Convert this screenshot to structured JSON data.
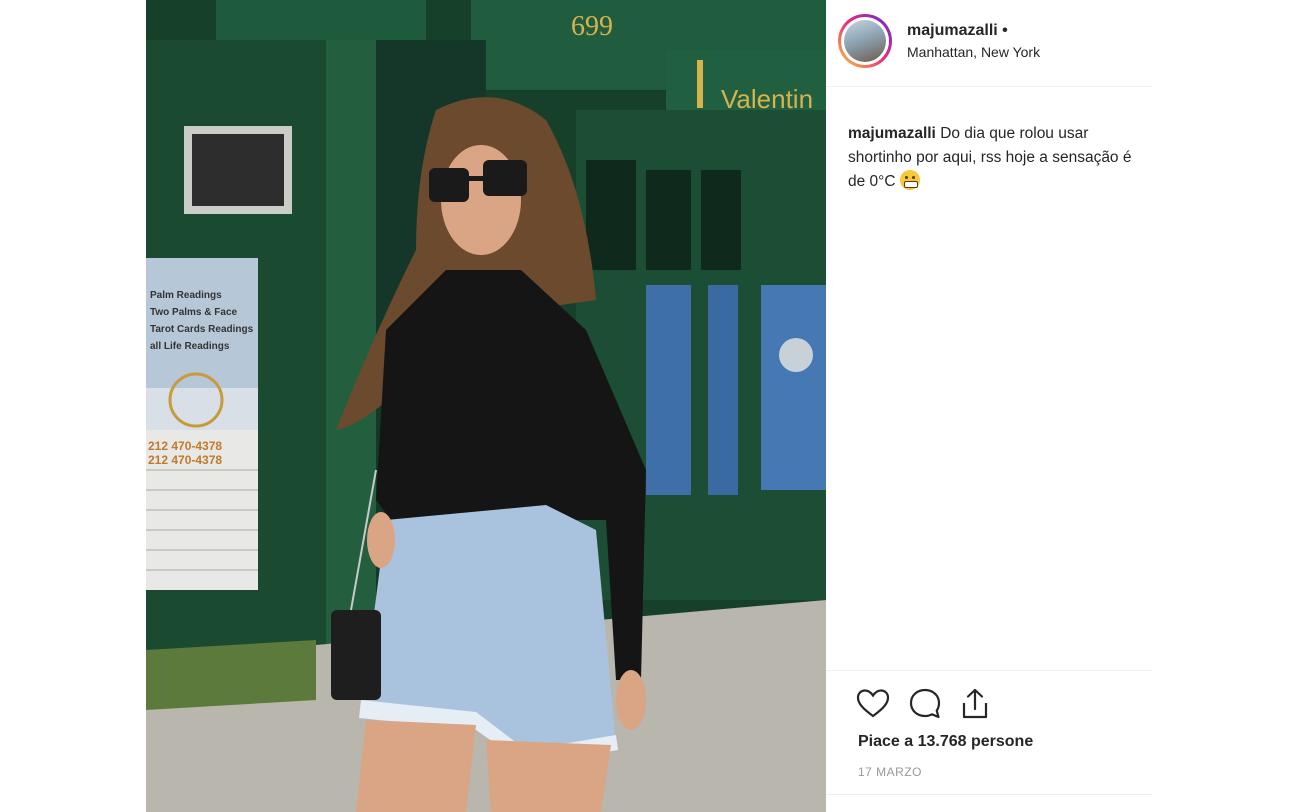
{
  "post": {
    "username": "majumazalli",
    "separator": "•",
    "location": "Manhattan, New York",
    "caption_user": "majumazalli",
    "caption_text": "Do dia que rolou usar shortinho por aqui, rss hoje a sensação é de 0°C",
    "caption_emoji": "grimacing-face-emoji",
    "likes": "Piace a 13.768 persone",
    "date": "17 MARZO"
  },
  "photo": {
    "storefront_number": "699",
    "storefront_sign": "Valentin",
    "window_sign_lines": [
      "Palm Readings",
      "Two Palms & Face",
      "Tarot Cards Readings",
      "all Life Readings"
    ],
    "phone_lines": [
      "212 470-4378",
      "212 470-4378"
    ]
  },
  "icons": {
    "like": "heart-icon",
    "comment": "comment-icon",
    "share": "share-icon"
  },
  "colors": {
    "storefront_green": "#1f5a3a",
    "sign_gold": "#d8b24a",
    "avatar_ring_start": "#f9ce34",
    "avatar_ring_end": "#6228d7"
  }
}
